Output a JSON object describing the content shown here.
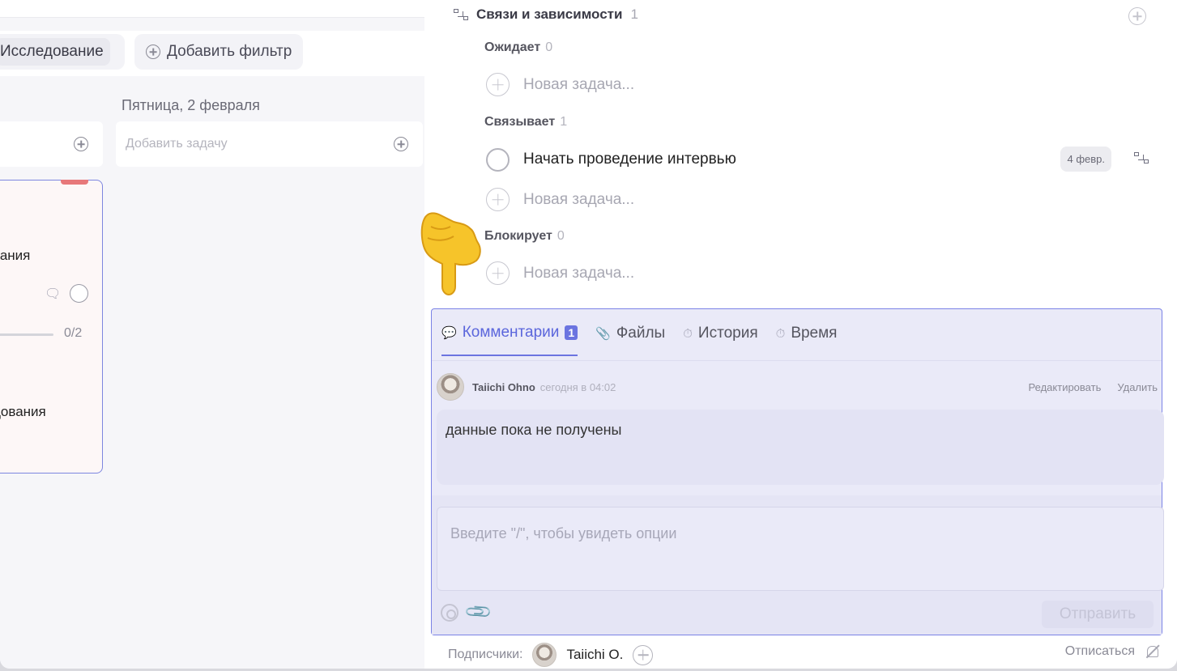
{
  "board": {
    "filter_chip": "Исследование",
    "add_filter": "Добавить фильтр",
    "day_title": "Пятница, 2 февраля",
    "add_task_placeholder": "Добавить задачу",
    "card": {
      "line1": "вания",
      "line2": "дования",
      "progress": "0/2",
      "progress_fraction": 0
    }
  },
  "panel": {
    "section_title": "Связи и зависимости",
    "section_count": "1",
    "groups": [
      {
        "label": "Ожидает",
        "count": "0"
      },
      {
        "label": "Связывает",
        "count": "1"
      },
      {
        "label": "Блокирует",
        "count": "0"
      }
    ],
    "new_task": "Новая задача...",
    "linked_task": {
      "name": "Начать проведение интервью",
      "date": "4 февр."
    },
    "tabs": {
      "comments": "Комментарии",
      "comments_count": "1",
      "files": "Файлы",
      "history": "История",
      "time": "Время"
    },
    "comment": {
      "author": "Taiichi Ohno",
      "time": "сегодня в 04:02",
      "edit": "Редактировать",
      "delete": "Удалить",
      "text": "данные пока не получены"
    },
    "input_placeholder": "Введите \"/\", чтобы увидеть опции",
    "send": "Отправить",
    "subscribers_label": "Подписчики:",
    "subscriber_name": "Taiichi O.",
    "unsubscribe": "Отписаться"
  }
}
